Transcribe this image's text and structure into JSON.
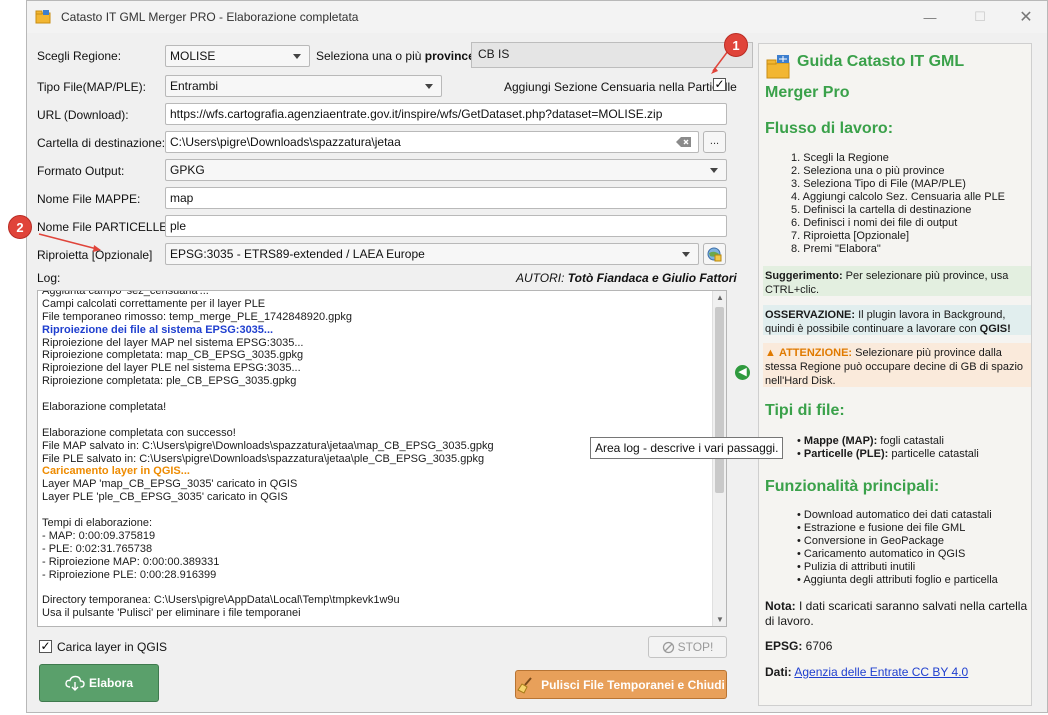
{
  "window": {
    "title": "Catasto IT GML Merger PRO - Elaborazione completata",
    "controls": {
      "minimize": "—",
      "maximize": "☐",
      "close": "✕"
    }
  },
  "form": {
    "regione_label": "Scegli Regione:",
    "regione_value": "MOLISE",
    "province_label_1": "Seleziona una o più ",
    "province_label_2": "province",
    "province_label_3": ":",
    "province_value": "CB  IS",
    "tipo_file_label": "Tipo File(MAP/PLE):",
    "tipo_file_value": "Entrambi",
    "sezione_label": "Aggiungi Sezione Censuaria nella Particelle",
    "sezione_checked": "✓",
    "url_label": "URL (Download):",
    "url_value": "https://wfs.cartografia.agenziaentrate.gov.it/inspire/wfs/GetDataset.php?dataset=MOLISE.zip",
    "cartella_label": "Cartella di destinazione:",
    "cartella_value": "C:\\Users\\pigre\\Downloads\\spazzatura\\jetaa",
    "browse_label": "...",
    "formato_label": "Formato Output:",
    "formato_value": "GPKG",
    "mappe_label": "Nome File MAPPE:",
    "mappe_value": "map",
    "particelle_label": "Nome File PARTICELLE:",
    "particelle_value": "ple",
    "riproietta_label": "Riproietta [Opzionale]",
    "riproietta_value": "EPSG:3035 - ETRS89-extended / LAEA Europe"
  },
  "annotations": {
    "badge1": "1",
    "badge2": "2"
  },
  "log": {
    "label": "Log:",
    "authors_prefix": "AUTORI: ",
    "authors": "Totò Fiandaca e Giulio Fattori",
    "lines": [
      {
        "text": "Aggiunta campo 'sez_censuaria'...",
        "style": ""
      },
      {
        "text": "Campi calcolati correttamente per il layer PLE",
        "style": ""
      },
      {
        "text": "File temporaneo rimosso: temp_merge_PLE_1742848920.gpkg",
        "style": ""
      },
      {
        "text": "Riproiezione dei file al sistema EPSG:3035...",
        "style": "blue"
      },
      {
        "text": "Riproiezione del layer MAP nel sistema EPSG:3035...",
        "style": ""
      },
      {
        "text": "Riproiezione completata: map_CB_EPSG_3035.gpkg",
        "style": ""
      },
      {
        "text": "Riproiezione del layer PLE nel sistema EPSG:3035...",
        "style": ""
      },
      {
        "text": "Riproiezione completata: ple_CB_EPSG_3035.gpkg",
        "style": ""
      },
      {
        "text": "",
        "style": ""
      },
      {
        "text": "Elaborazione completata!",
        "style": ""
      },
      {
        "text": "",
        "style": ""
      },
      {
        "text": "Elaborazione completata con successo!",
        "style": ""
      },
      {
        "text": "File MAP salvato in: C:\\Users\\pigre\\Downloads\\spazzatura\\jetaa\\map_CB_EPSG_3035.gpkg",
        "style": ""
      },
      {
        "text": "File PLE salvato in: C:\\Users\\pigre\\Downloads\\spazzatura\\jetaa\\ple_CB_EPSG_3035.gpkg",
        "style": ""
      },
      {
        "text": "Caricamento layer in QGIS...",
        "style": "orange"
      },
      {
        "text": "Layer MAP 'map_CB_EPSG_3035' caricato in QGIS",
        "style": ""
      },
      {
        "text": "Layer PLE 'ple_CB_EPSG_3035' caricato in QGIS",
        "style": ""
      },
      {
        "text": "",
        "style": ""
      },
      {
        "text": "Tempi di elaborazione:",
        "style": ""
      },
      {
        "text": "- MAP: 0:00:09.375819",
        "style": ""
      },
      {
        "text": "- PLE: 0:02:31.765738",
        "style": ""
      },
      {
        "text": "- Riproiezione MAP: 0:00:00.389331",
        "style": ""
      },
      {
        "text": "- Riproiezione PLE: 0:00:28.916399",
        "style": ""
      },
      {
        "text": "",
        "style": ""
      },
      {
        "text": "Directory temporanea: C:\\Users\\pigre\\AppData\\Local\\Temp\\tmpkevk1w9u",
        "style": ""
      },
      {
        "text": "Usa il pulsante 'Pulisci' per eliminare i file temporanei",
        "style": ""
      }
    ],
    "tooltip": "Area log - descrive i vari passaggi."
  },
  "bottom": {
    "carica_label": "Carica layer in QGIS",
    "carica_checked": "✓",
    "stop_label": "STOP!",
    "elabora_label": "Elabora",
    "pulisci_label": "Pulisci File Temporanei e Chiudi"
  },
  "guide": {
    "title_line1": "Guida Catasto IT GML",
    "title_line2": "Merger Pro",
    "flusso_title": "Flusso di lavoro:",
    "flusso_steps": [
      "1. Scegli la Regione",
      "2. Seleziona una o più province",
      "3. Seleziona Tipo di File (MAP/PLE)",
      "4. Aggiungi calcolo Sez. Censuaria alle PLE",
      "5. Definisci la cartella di destinazione",
      "6. Definisci i nomi dei file di output",
      "7. Riproietta [Opzionale]",
      "8. Premi \"Elabora\""
    ],
    "suggerimento_label": "Suggerimento:",
    "suggerimento_text": " Per selezionare più province, usa CTRL+clic.",
    "osservazione_label": "OSSERVAZIONE:",
    "osservazione_text": " Il plugin lavora in Background, quindi è possibile continuare a lavorare con ",
    "osservazione_qgis": "QGIS!",
    "attenzione_label": "ATTENZIONE:",
    "attenzione_text": " Selezionare più province dalla stessa Regione può occupare decine di GB di spazio nell'Hard Disk.",
    "tipi_title": "Tipi di file:",
    "tipi_items": [
      {
        "bold": "Mappe (MAP):",
        "text": " fogli catastali"
      },
      {
        "bold": "Particelle (PLE):",
        "text": " particelle catastali"
      }
    ],
    "funz_title": "Funzionalità principali:",
    "funz_items": [
      "Download automatico dei dati catastali",
      "Estrazione e fusione dei file GML",
      "Conversione in GeoPackage",
      "Caricamento automatico in QGIS",
      "Pulizia di attributi inutili",
      "Aggiunta degli attributi foglio e particella"
    ],
    "nota_label": "Nota:",
    "nota_text": " I dati scaricati saranno salvati nella cartella di lavoro.",
    "epsg_label": "EPSG:",
    "epsg_value": " 6706",
    "dati_label": "Dati:",
    "dati_link": "Agenzia delle Entrate CC BY 4.0"
  },
  "colors": {
    "accent_green": "#3aa14a",
    "elabora_bg": "#5aa06b",
    "pulisci_bg": "#e8a05a",
    "log_blue": "#1f3fcf",
    "log_orange": "#ee8b00",
    "badge_red": "#e0443a"
  }
}
